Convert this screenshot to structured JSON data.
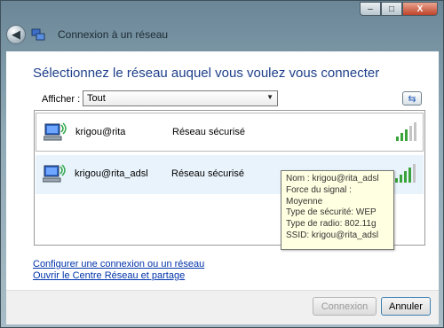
{
  "window": {
    "title": "Connexion à un réseau",
    "controls": {
      "minimize": "‒",
      "maximize": "□",
      "close": "X"
    }
  },
  "main": {
    "heading": "Sélectionnez le réseau auquel vous voulez vous connecter",
    "filter": {
      "label": "Afficher :",
      "selected": "Tout"
    },
    "networks": [
      {
        "name": "krigou@rita",
        "security": "Réseau sécurisé"
      },
      {
        "name": "krigou@rita_adsl",
        "security": "Réseau sécurisé"
      }
    ],
    "tooltip": {
      "lines": [
        "Nom : krigou@rita_adsl",
        "Force du signal : Moyenne",
        "Type de sécurité: WEP",
        "Type de radio: 802.11g",
        "SSID: krigou@rita_adsl"
      ]
    },
    "links": {
      "configure": "Configurer une connexion ou un réseau",
      "open_center": "Ouvrir le Centre Réseau et partage"
    }
  },
  "footer": {
    "connect_label": "Connexion",
    "cancel_label": "Annuler"
  },
  "colors": {
    "heading": "#1e3f8a",
    "link": "#0033aa",
    "signal": "#3aa33a",
    "tooltip_bg": "#ffffe1"
  }
}
